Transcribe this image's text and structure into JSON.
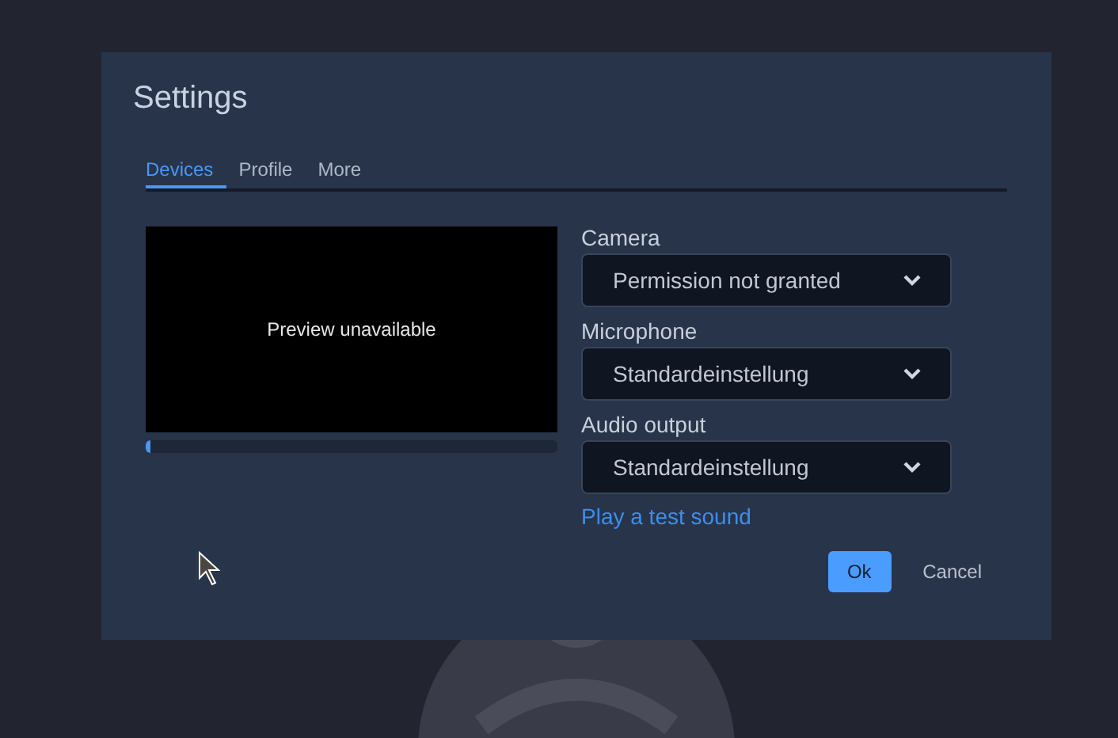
{
  "window": {
    "title": "Settings"
  },
  "tabs": [
    {
      "label": "Devices",
      "selected": true
    },
    {
      "label": "Profile",
      "selected": false
    },
    {
      "label": "More",
      "selected": false
    }
  ],
  "preview": {
    "message": "Preview unavailable",
    "level": 0.01
  },
  "devices": [
    {
      "label": "Camera",
      "value": "Permission not granted"
    },
    {
      "label": "Microphone",
      "value": "Standardeinstellung"
    },
    {
      "label": "Audio output",
      "value": "Standardeinstellung"
    }
  ],
  "test_link": "Play a test sound",
  "buttons": [
    {
      "label": "Ok",
      "kind": "primary"
    },
    {
      "label": "Cancel",
      "kind": "plain"
    }
  ]
}
